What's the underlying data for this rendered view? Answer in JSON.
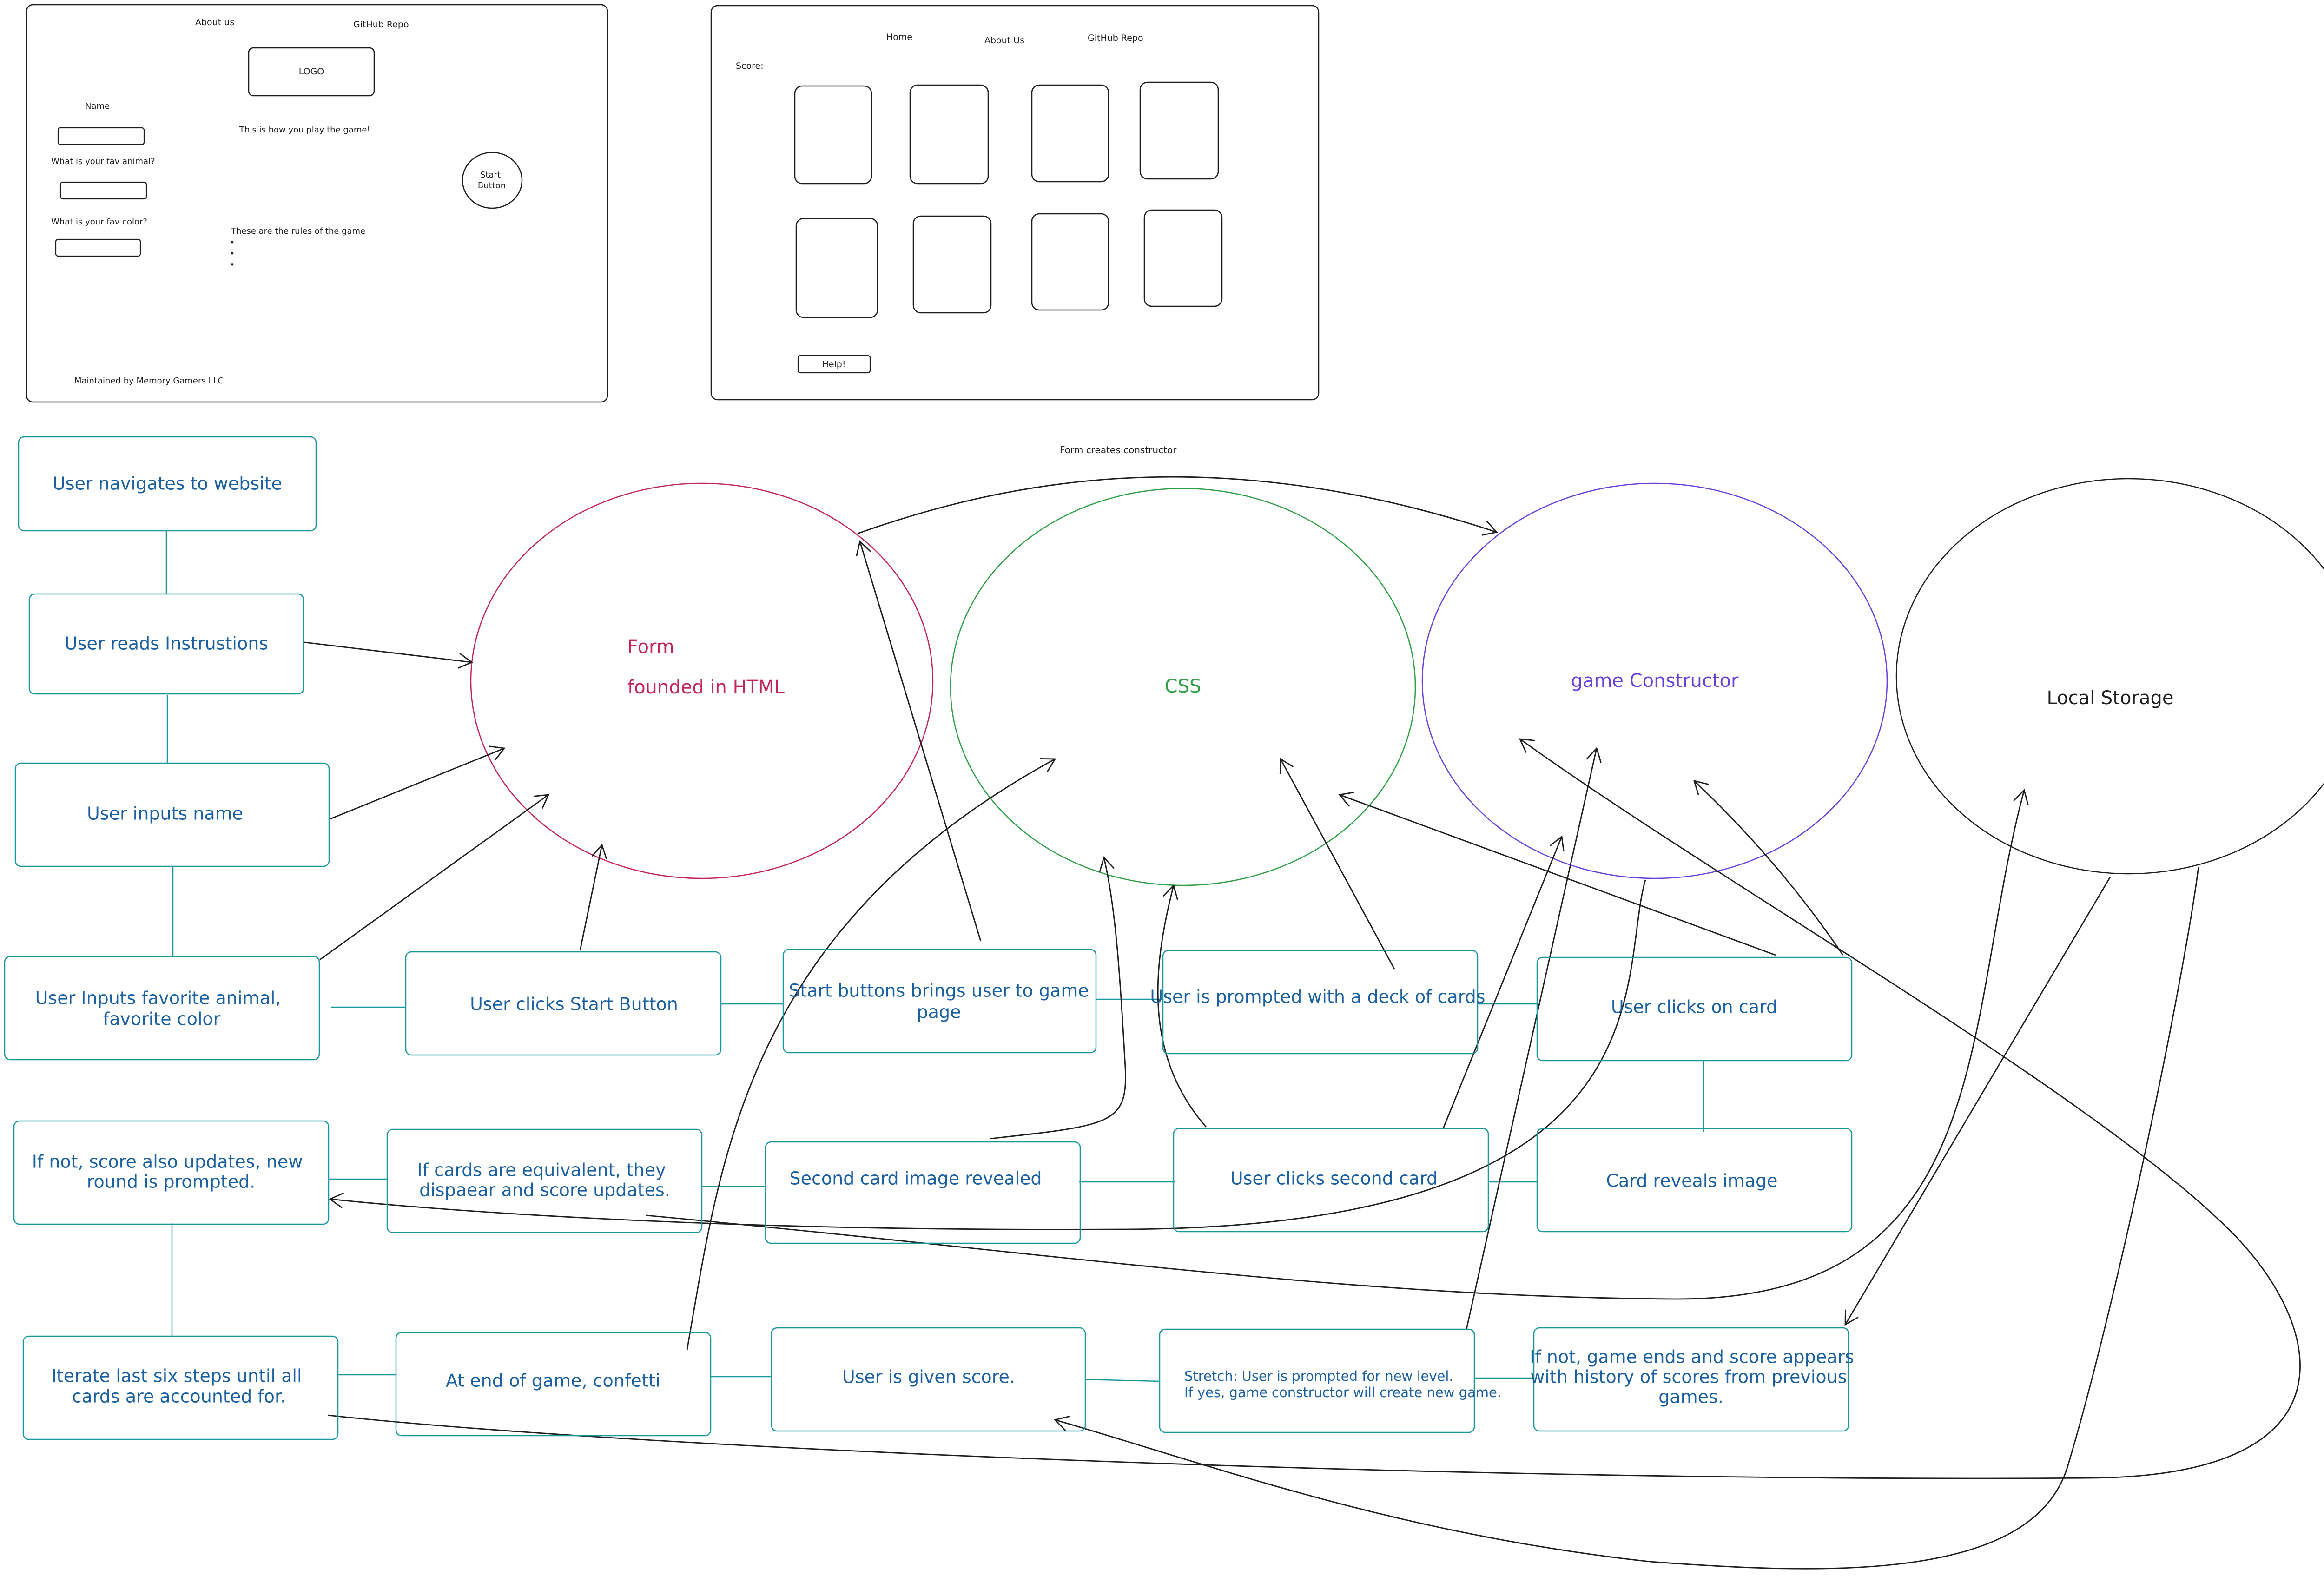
{
  "wireframe_home": {
    "nav_about": "About us",
    "nav_github": "GitHub Repo",
    "logo": "LOGO",
    "name_label": "Name",
    "animal_label": "What is your fav animal?",
    "color_label": "What is your fav color?",
    "howto": "This is how you play the game!",
    "start_button_line1": "Start",
    "start_button_line2": "Button",
    "rules": "These are the rules of the game",
    "rules_bullets": [
      "•",
      "•",
      "•"
    ],
    "footer": "Maintained by Memory Gamers LLC"
  },
  "wireframe_game": {
    "nav_home": "Home",
    "nav_about": "About Us",
    "nav_github": "GitHub Repo",
    "score_label": "Score:",
    "help_button": "Help!"
  },
  "ellipses": {
    "form_line1": "Form",
    "form_line2": "founded in HTML",
    "css": "CSS",
    "constructor": "game Constructor",
    "storage": "Local Storage"
  },
  "arrow_label": "Form creates constructor",
  "steps": {
    "navigate": "User navigates to website",
    "reads": "User reads Instrustions",
    "inputs_name": "User inputs name",
    "inputs_fav_1": "User Inputs favorite animal,",
    "inputs_fav_2": "favorite color",
    "start": "User clicks Start Button",
    "start_brings_1": "Start buttons brings user to game",
    "start_brings_2": "page",
    "prompted_deck": "User is prompted with a deck of cards",
    "clicks_card": "User clicks on card",
    "if_not_1": "If not, score also updates, new",
    "if_not_2": "round is prompted.",
    "equivalent_1": "If cards are equivalent, they",
    "equivalent_2": "dispaear and score updates.",
    "second_revealed": "Second card image revealed",
    "clicks_second": "User clicks second card",
    "reveals_image": "Card reveals image",
    "iterate_1": "Iterate last six steps until all",
    "iterate_2": "cards are accounted for.",
    "confetti": "At end of game, confetti",
    "given_score": "User is given score.",
    "stretch_1": "Stretch: User is prompted for new level.",
    "stretch_2": "If yes, game constructor will create new game.",
    "game_ends_1": "If not, game ends and score appears",
    "game_ends_2": "with history of scores from previous",
    "game_ends_3": "games."
  },
  "colors": {
    "box_stroke": "#1a98a0",
    "step_text": "#1a5fa0",
    "form": "#c2255c",
    "css": "#2f9e44",
    "constructor": "#6741d9",
    "storage": "#1e1e1e"
  }
}
